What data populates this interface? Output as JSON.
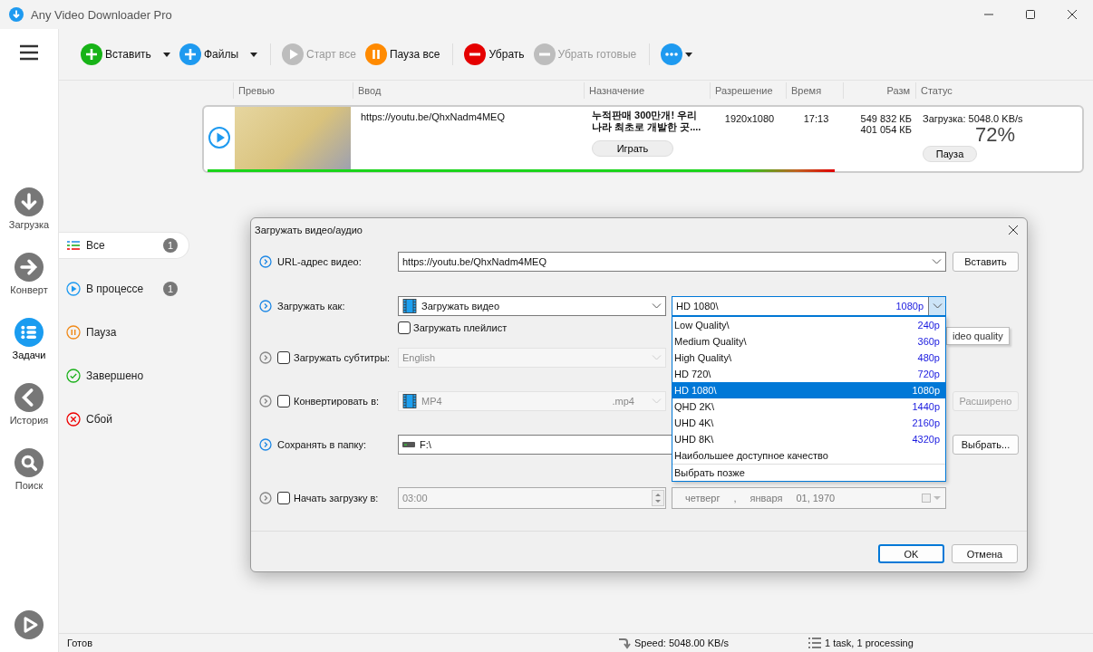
{
  "window": {
    "title": "Any Video Downloader Pro"
  },
  "nav": {
    "items": [
      {
        "label": "Загрузка",
        "kind": "download",
        "selected": false
      },
      {
        "label": "Конверт",
        "kind": "convert",
        "selected": false
      },
      {
        "label": "Задачи",
        "kind": "tasks",
        "selected": true
      },
      {
        "label": "История",
        "kind": "history",
        "selected": false
      },
      {
        "label": "Поиск",
        "kind": "search",
        "selected": false
      }
    ]
  },
  "toolbar": {
    "groups": [
      {
        "buttons": [
          {
            "kind": "paste",
            "label": "Вставить",
            "disabled": false,
            "dropdown": true
          },
          {
            "kind": "files",
            "label": "Файлы",
            "disabled": false,
            "dropdown": true
          }
        ]
      },
      {
        "buttons": [
          {
            "kind": "start",
            "label": "Старт все",
            "disabled": true,
            "dropdown": false
          },
          {
            "kind": "pause",
            "label": "Пауза все",
            "disabled": false,
            "dropdown": false
          }
        ]
      },
      {
        "buttons": [
          {
            "kind": "remove",
            "label": "Убрать",
            "disabled": false,
            "dropdown": false
          },
          {
            "kind": "clear",
            "label": "Убрать готовые",
            "disabled": true,
            "dropdown": false
          }
        ]
      },
      {
        "buttons": [
          {
            "kind": "more",
            "disabled": false,
            "dropdown": true
          }
        ]
      }
    ]
  },
  "filters": [
    {
      "label": "Все",
      "kind": "all",
      "count": "1",
      "selected": true
    },
    {
      "label": "В процессе",
      "kind": "progress",
      "count": "1",
      "selected": false
    },
    {
      "label": "Пауза",
      "kind": "paused",
      "selected": false
    },
    {
      "label": "Завершено",
      "kind": "done",
      "selected": false
    },
    {
      "label": "Сбой",
      "kind": "failed",
      "selected": false
    }
  ],
  "table": {
    "columns": [
      "Превью",
      "Ввод",
      "Назначение",
      "Разрешение",
      "Время",
      "Разм",
      "Статус"
    ],
    "rows": [
      {
        "url": "https://youtu.be/QhxNadm4MEQ",
        "title": "누적판매 300만개! 우리 나라 최초로 개발한 곳....",
        "resolution": "1920x1080",
        "duration": "17:13",
        "sizes": [
          "549 832 КБ",
          "401 054 КБ"
        ],
        "status": "Загрузка: 5048.0 KB/s",
        "percent": "72%",
        "level": 0.72,
        "play_button": "Играть",
        "pause_button": "Пауза"
      }
    ]
  },
  "status_bar": {
    "text": "Готов",
    "speed": "Speed: 5048.00 KB/s",
    "tasks": "1 task, 1 processing"
  },
  "dialog": {
    "title": "Загружать видео/аудио",
    "url": {
      "label": "URL-адрес видео:",
      "value": "https://youtu.be/QhxNadm4MEQ",
      "button": "Вставить"
    },
    "download_as": {
      "label": "Загружать как:",
      "value": "Загружать видео",
      "quality": "HD 1080\\",
      "quality_res": "1080p",
      "expanded": true,
      "playlist": {
        "label": "Загружать плейлист",
        "checked": false
      },
      "options": [
        {
          "name": "Low Quality\\",
          "res": "240p",
          "selected": false
        },
        {
          "name": "Medium Quality\\",
          "res": "360p",
          "selected": false
        },
        {
          "name": "High Quality\\",
          "res": "480p",
          "selected": false
        },
        {
          "name": "HD 720\\",
          "res": "720p",
          "selected": false
        },
        {
          "name": "HD 1080\\",
          "res": "1080p",
          "selected": true
        },
        {
          "name": "QHD 2K\\",
          "res": "1440p",
          "selected": false
        },
        {
          "name": "UHD 4K\\",
          "res": "2160p",
          "selected": false
        },
        {
          "name": "UHD 8K\\",
          "res": "4320p",
          "selected": false
        },
        {
          "name": "Наибольшее доступное качество",
          "selected": false
        }
      ],
      "after_divider": [
        {
          "name": "Выбрать позже",
          "selected": false
        }
      ],
      "tooltip": "ideo quality"
    },
    "subtitles": {
      "label": "Загружать субтитры:",
      "checked": false,
      "value": "English"
    },
    "convert": {
      "label": "Конвертировать в:",
      "checked": false,
      "format": "MP4",
      "extension": ".mp4",
      "button": "Расширено"
    },
    "folder": {
      "label": "Сохранять в папку:",
      "value": "F:\\",
      "button": "Выбрать..."
    },
    "schedule": {
      "label": "Начать загрузку в:",
      "checked": false,
      "time": "03:00",
      "date": [
        "четверг",
        ",",
        "января",
        "01, 1970"
      ]
    },
    "buttons": [
      "OK",
      "Отмена"
    ]
  }
}
